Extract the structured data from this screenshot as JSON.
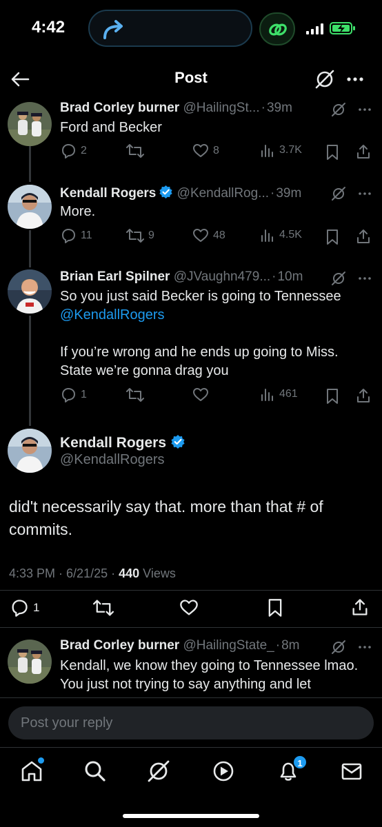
{
  "status_bar": {
    "time": "4:42"
  },
  "header": {
    "title": "Post"
  },
  "thread": [
    {
      "name": "Brad Corley burner",
      "handle": "@HailingSt...",
      "time": "39m",
      "text": "Ford and Becker",
      "replies": "2",
      "reposts": "",
      "likes": "8",
      "views": "3.7K"
    },
    {
      "name": "Kendall Rogers",
      "verified": true,
      "handle": "@KendallRog...",
      "time": "39m",
      "text": "More.",
      "replies": "11",
      "reposts": "9",
      "likes": "48",
      "views": "4.5K"
    },
    {
      "name": "Brian Earl Spilner",
      "handle": "@JVaughn479...",
      "time": "10m",
      "text_line1": "So you just said Becker is going to Tennessee",
      "mention": "@KendallRogers",
      "text_line2": "If you’re wrong and he ends up going to Miss. State we’re gonna drag you",
      "replies": "1",
      "reposts": "",
      "likes": "",
      "views": "461"
    }
  ],
  "main_post": {
    "name": "Kendall Rogers",
    "handle": "@KendallRogers",
    "text": "did't necessarily say that. more than that # of commits.",
    "time": "4:33 PM",
    "date": "6/21/25",
    "views_count": "440",
    "views_label": "Views",
    "replies": "1"
  },
  "next_reply": {
    "name": "Brad Corley burner",
    "handle": "@HailingState_",
    "time": "8m",
    "text": "Kendall, we know they going to Tennessee lmao. You just not trying to say anything and let"
  },
  "reply_bar": {
    "placeholder": "Post your reply"
  },
  "nav": {
    "notifications_badge": "1"
  },
  "colors": {
    "accent": "#1d9bf0",
    "muted": "#71767b",
    "background": "#000000"
  }
}
